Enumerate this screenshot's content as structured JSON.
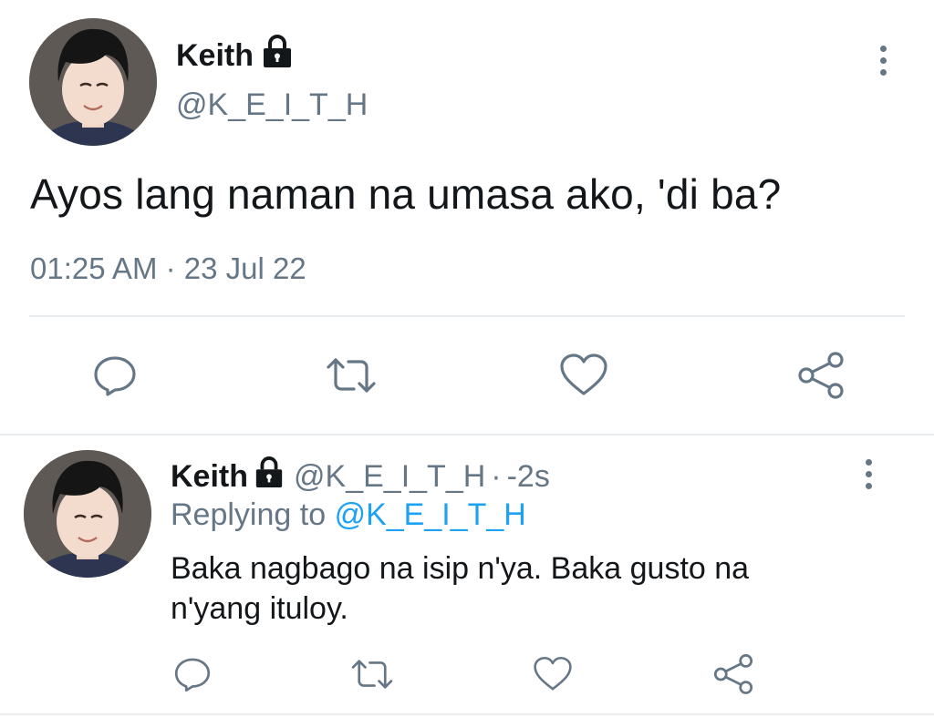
{
  "main_tweet": {
    "name": "Keith",
    "handle": "@K_E_I_T_H",
    "text": "Ayos lang naman na umasa ako, 'di ba?",
    "time": "01:25 AM",
    "separator": "·",
    "date": "23 Jul 22",
    "icons": {
      "verified_lock": "lock-icon",
      "more": "more-vertical-icon",
      "reply": "reply-icon",
      "retweet": "retweet-icon",
      "like": "heart-icon",
      "share": "share-icon"
    }
  },
  "reply_tweet": {
    "name": "Keith",
    "handle": "@K_E_I_T_H",
    "separator": "·",
    "time": "-2s",
    "replying_prefix": "Replying to",
    "replying_to": "@K_E_I_T_H",
    "text": "Baka nagbago na isip n'ya. Baka gusto na n'yang ituloy."
  },
  "colors": {
    "text": "#14171a",
    "secondary": "#657786",
    "link": "#1da1f2",
    "divider": "#e6ecf0"
  }
}
